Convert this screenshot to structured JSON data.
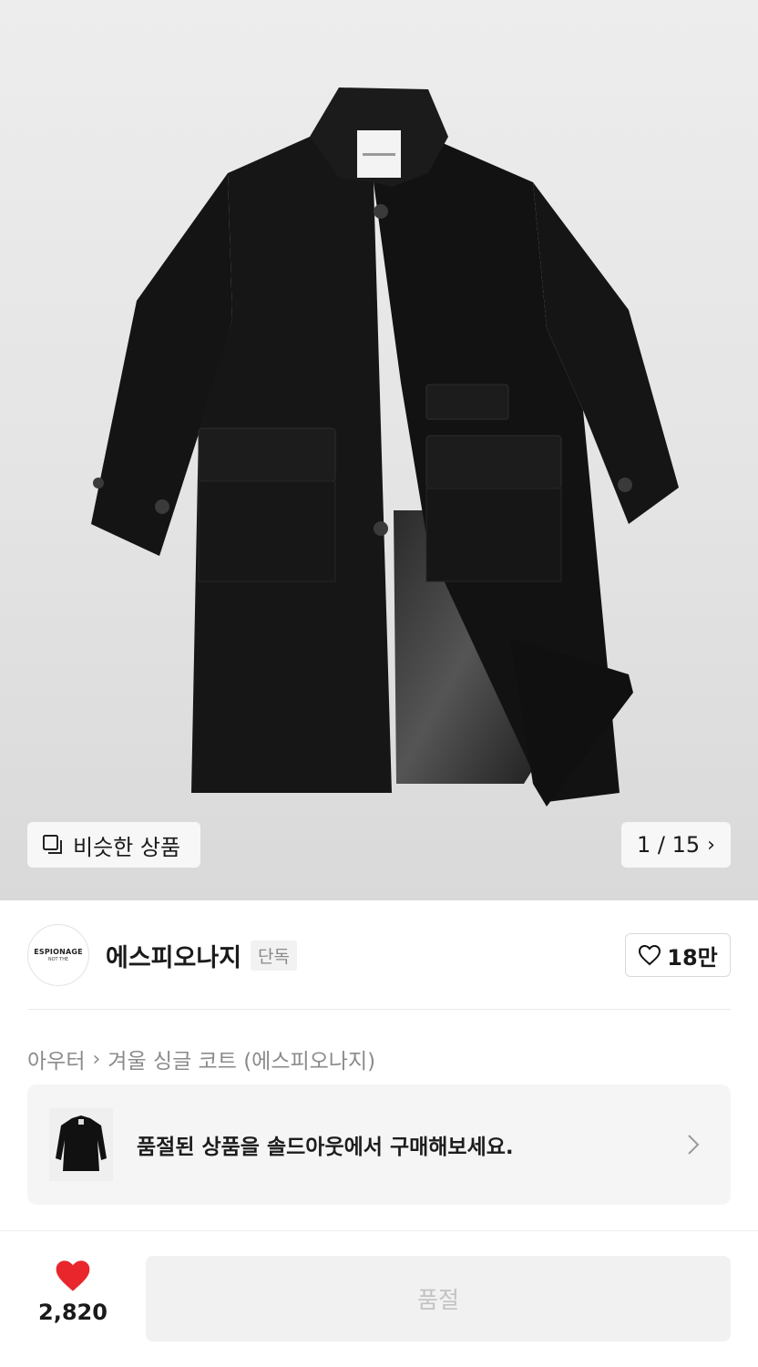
{
  "hero": {
    "similar_label": "비슷한 상품",
    "counter": "1 / 15",
    "image_icon": "coat-product-photo"
  },
  "brand": {
    "logo_line1": "ESPIONAGE",
    "logo_line2": "NOT THE",
    "name": "에스피오나지",
    "badge": "단독",
    "likes": "18만"
  },
  "breadcrumb": {
    "category": "아우터",
    "product": "겨울 싱글 코트 (에스피오나지)"
  },
  "banner": {
    "text": "품절된 상품을 솔드아웃에서 구매해보세요."
  },
  "bottom": {
    "wish_count": "2,820",
    "buy_label": "품절"
  },
  "colors": {
    "heart_red": "#e8262c",
    "disabled_text": "#c2c2c2"
  }
}
